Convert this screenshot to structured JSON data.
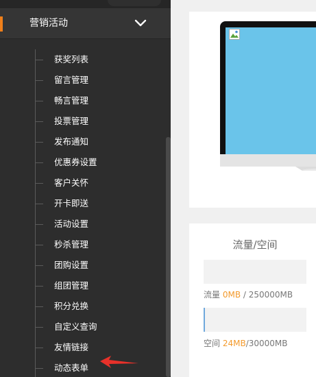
{
  "sidebar": {
    "group": {
      "label": "营销活动",
      "icon": "chevron-down-icon",
      "accent_color": "#ef7f1a"
    },
    "items": [
      {
        "label": "获奖列表"
      },
      {
        "label": "留言管理"
      },
      {
        "label": "畅言管理"
      },
      {
        "label": "投票管理"
      },
      {
        "label": "发布通知"
      },
      {
        "label": "优惠券设置"
      },
      {
        "label": "客户关怀"
      },
      {
        "label": "开卡即送"
      },
      {
        "label": "活动设置"
      },
      {
        "label": "秒杀管理"
      },
      {
        "label": "团购设置"
      },
      {
        "label": "组团管理"
      },
      {
        "label": "积分兑换"
      },
      {
        "label": "自定义查询"
      },
      {
        "label": "友情链接"
      },
      {
        "label": "动态表单"
      }
    ],
    "annotation_arrow_color": "#e8312a"
  },
  "preview_card": {
    "icon": "broken-image-icon",
    "screen_color": "#6ac4ea"
  },
  "stats": {
    "title": "流量/空间",
    "traffic": {
      "label": "流量",
      "used": "0MB",
      "separator": " / ",
      "total": "250000MB",
      "used_fraction": 0
    },
    "space": {
      "label": "空间",
      "used": "24MB",
      "separator": "/",
      "total": "30000MB",
      "used_fraction": 0.0008
    },
    "highlight_color": "#f39a2c"
  }
}
